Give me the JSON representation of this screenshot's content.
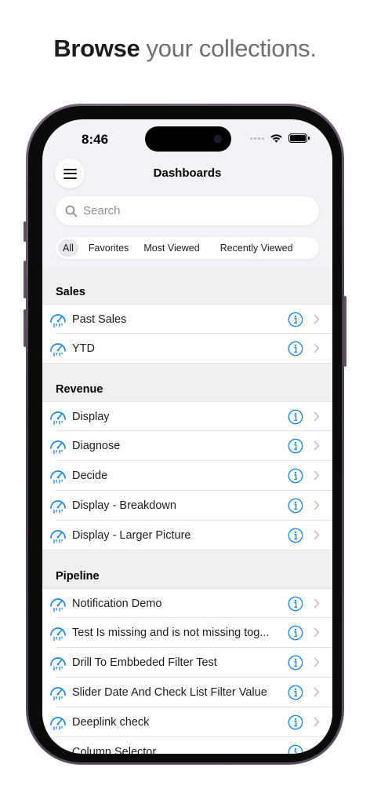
{
  "headline": {
    "bold": "Browse",
    "light": "your collections."
  },
  "status": {
    "time": "8:46"
  },
  "nav": {
    "title": "Dashboards"
  },
  "search": {
    "placeholder": "Search"
  },
  "filters": [
    "All",
    "Favorites",
    "Most Viewed",
    "Recently Viewed"
  ],
  "selected_filter": "All",
  "sections": [
    {
      "title": "Sales",
      "items": [
        "Past Sales",
        "YTD"
      ]
    },
    {
      "title": "Revenue",
      "items": [
        "Display",
        "Diagnose",
        "Decide",
        "Display -  Breakdown",
        "Display - Larger Picture"
      ]
    },
    {
      "title": "Pipeline",
      "items": [
        "Notification Demo",
        "Test Is missing and is not missing tog...",
        "Drill To Embbeded Filter Test",
        "Slider Date And Check List Filter Value",
        "Deeplink check",
        "Column Selector"
      ]
    }
  ],
  "colors": {
    "accent": "#1e88e5",
    "background": "#f2f2f7",
    "frame": "#5c4e62"
  },
  "icons": {
    "row_icon": "gauge-icon",
    "info": "info-icon",
    "disclosure": "chevron-right-icon"
  }
}
